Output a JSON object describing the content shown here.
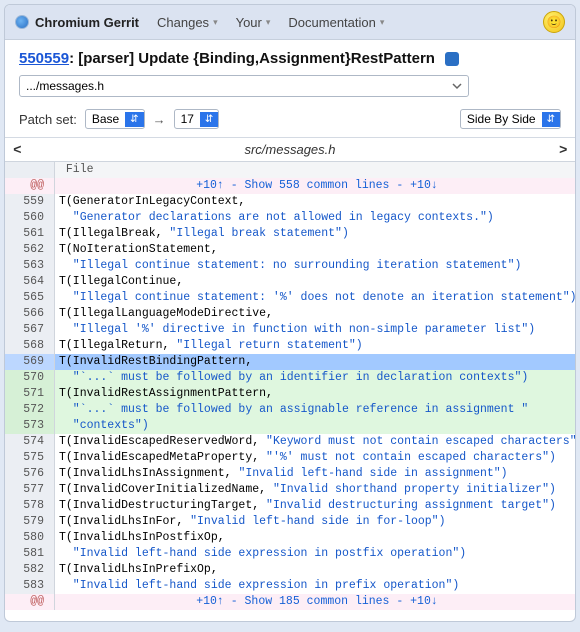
{
  "header": {
    "brand": "Chromium Gerrit",
    "nav": [
      "Changes",
      "Your",
      "Documentation"
    ]
  },
  "change": {
    "number": "550559",
    "title": ": [parser] Update {Binding,Assignment}RestPattern"
  },
  "path_field": ".../messages.h",
  "controls": {
    "patchset_label": "Patch set:",
    "base": "Base",
    "target": "17",
    "view_mode": "Side By Side"
  },
  "file_header": "src/messages.h",
  "file_label": "File",
  "context_top": "+10↑ - Show 558 common lines - +10↓",
  "context_bottom": "+10↑ - Show 185 common lines - +10↓",
  "lines": [
    {
      "n": 559,
      "k": "n",
      "t": "T(GeneratorInLegacyContext,"
    },
    {
      "n": 560,
      "k": "n",
      "s": "  \"Generator declarations are not allowed in legacy contexts.\")"
    },
    {
      "n": 561,
      "k": "n",
      "t": "T(IllegalBreak, ",
      "s": "\"Illegal break statement\")"
    },
    {
      "n": 562,
      "k": "n",
      "t": "T(NoIterationStatement,"
    },
    {
      "n": 563,
      "k": "n",
      "s": "  \"Illegal continue statement: no surrounding iteration statement\")"
    },
    {
      "n": 564,
      "k": "n",
      "t": "T(IllegalContinue,"
    },
    {
      "n": 565,
      "k": "n",
      "s": "  \"Illegal continue statement: '%' does not denote an iteration statement\")"
    },
    {
      "n": 566,
      "k": "n",
      "t": "T(IllegalLanguageModeDirective,"
    },
    {
      "n": 567,
      "k": "n",
      "s": "  \"Illegal '%' directive in function with non-simple parameter list\")"
    },
    {
      "n": 568,
      "k": "n",
      "t": "T(IllegalReturn, ",
      "s": "\"Illegal return statement\")"
    },
    {
      "n": 569,
      "k": "hl",
      "t": "T(InvalidRestBindingPattern,"
    },
    {
      "n": 570,
      "k": "a",
      "s": "  \"`...` must be followed by an identifier in declaration contexts\")"
    },
    {
      "n": 571,
      "k": "a",
      "t": "T(InvalidRestAssignmentPattern,"
    },
    {
      "n": 572,
      "k": "a",
      "s": "  \"`...` must be followed by an assignable reference in assignment \""
    },
    {
      "n": 573,
      "k": "a",
      "s": "  \"contexts\")"
    },
    {
      "n": 574,
      "k": "n",
      "t": "T(InvalidEscapedReservedWord, ",
      "s": "\"Keyword must not contain escaped characters\")"
    },
    {
      "n": 575,
      "k": "n",
      "t": "T(InvalidEscapedMetaProperty, ",
      "s": "\"'%' must not contain escaped characters\")"
    },
    {
      "n": 576,
      "k": "n",
      "t": "T(InvalidLhsInAssignment, ",
      "s": "\"Invalid left-hand side in assignment\")"
    },
    {
      "n": 577,
      "k": "n",
      "t": "T(InvalidCoverInitializedName, ",
      "s": "\"Invalid shorthand property initializer\")"
    },
    {
      "n": 578,
      "k": "n",
      "t": "T(InvalidDestructuringTarget, ",
      "s": "\"Invalid destructuring assignment target\")"
    },
    {
      "n": 579,
      "k": "n",
      "t": "T(InvalidLhsInFor, ",
      "s": "\"Invalid left-hand side in for-loop\")"
    },
    {
      "n": 580,
      "k": "n",
      "t": "T(InvalidLhsInPostfixOp,"
    },
    {
      "n": 581,
      "k": "n",
      "s": "  \"Invalid left-hand side expression in postfix operation\")"
    },
    {
      "n": 582,
      "k": "n",
      "t": "T(InvalidLhsInPrefixOp,"
    },
    {
      "n": 583,
      "k": "n",
      "s": "  \"Invalid left-hand side expression in prefix operation\")"
    }
  ]
}
